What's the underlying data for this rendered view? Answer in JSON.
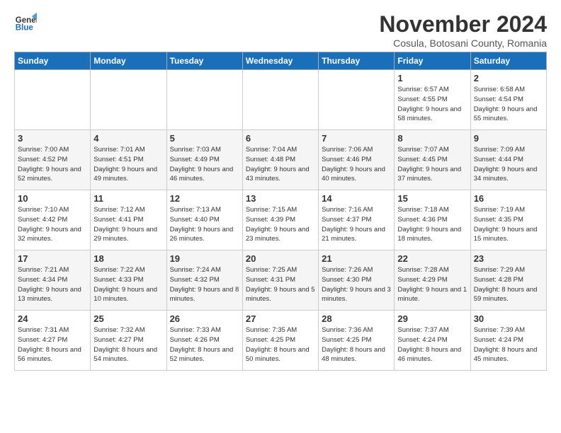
{
  "logo": {
    "line1": "General",
    "line2": "Blue"
  },
  "title": "November 2024",
  "subtitle": "Cosula, Botosani County, Romania",
  "days_of_week": [
    "Sunday",
    "Monday",
    "Tuesday",
    "Wednesday",
    "Thursday",
    "Friday",
    "Saturday"
  ],
  "weeks": [
    [
      {
        "day": "",
        "text": ""
      },
      {
        "day": "",
        "text": ""
      },
      {
        "day": "",
        "text": ""
      },
      {
        "day": "",
        "text": ""
      },
      {
        "day": "",
        "text": ""
      },
      {
        "day": "1",
        "text": "Sunrise: 6:57 AM\nSunset: 4:55 PM\nDaylight: 9 hours and 58 minutes."
      },
      {
        "day": "2",
        "text": "Sunrise: 6:58 AM\nSunset: 4:54 PM\nDaylight: 9 hours and 55 minutes."
      }
    ],
    [
      {
        "day": "3",
        "text": "Sunrise: 7:00 AM\nSunset: 4:52 PM\nDaylight: 9 hours and 52 minutes."
      },
      {
        "day": "4",
        "text": "Sunrise: 7:01 AM\nSunset: 4:51 PM\nDaylight: 9 hours and 49 minutes."
      },
      {
        "day": "5",
        "text": "Sunrise: 7:03 AM\nSunset: 4:49 PM\nDaylight: 9 hours and 46 minutes."
      },
      {
        "day": "6",
        "text": "Sunrise: 7:04 AM\nSunset: 4:48 PM\nDaylight: 9 hours and 43 minutes."
      },
      {
        "day": "7",
        "text": "Sunrise: 7:06 AM\nSunset: 4:46 PM\nDaylight: 9 hours and 40 minutes."
      },
      {
        "day": "8",
        "text": "Sunrise: 7:07 AM\nSunset: 4:45 PM\nDaylight: 9 hours and 37 minutes."
      },
      {
        "day": "9",
        "text": "Sunrise: 7:09 AM\nSunset: 4:44 PM\nDaylight: 9 hours and 34 minutes."
      }
    ],
    [
      {
        "day": "10",
        "text": "Sunrise: 7:10 AM\nSunset: 4:42 PM\nDaylight: 9 hours and 32 minutes."
      },
      {
        "day": "11",
        "text": "Sunrise: 7:12 AM\nSunset: 4:41 PM\nDaylight: 9 hours and 29 minutes."
      },
      {
        "day": "12",
        "text": "Sunrise: 7:13 AM\nSunset: 4:40 PM\nDaylight: 9 hours and 26 minutes."
      },
      {
        "day": "13",
        "text": "Sunrise: 7:15 AM\nSunset: 4:39 PM\nDaylight: 9 hours and 23 minutes."
      },
      {
        "day": "14",
        "text": "Sunrise: 7:16 AM\nSunset: 4:37 PM\nDaylight: 9 hours and 21 minutes."
      },
      {
        "day": "15",
        "text": "Sunrise: 7:18 AM\nSunset: 4:36 PM\nDaylight: 9 hours and 18 minutes."
      },
      {
        "day": "16",
        "text": "Sunrise: 7:19 AM\nSunset: 4:35 PM\nDaylight: 9 hours and 15 minutes."
      }
    ],
    [
      {
        "day": "17",
        "text": "Sunrise: 7:21 AM\nSunset: 4:34 PM\nDaylight: 9 hours and 13 minutes."
      },
      {
        "day": "18",
        "text": "Sunrise: 7:22 AM\nSunset: 4:33 PM\nDaylight: 9 hours and 10 minutes."
      },
      {
        "day": "19",
        "text": "Sunrise: 7:24 AM\nSunset: 4:32 PM\nDaylight: 9 hours and 8 minutes."
      },
      {
        "day": "20",
        "text": "Sunrise: 7:25 AM\nSunset: 4:31 PM\nDaylight: 9 hours and 5 minutes."
      },
      {
        "day": "21",
        "text": "Sunrise: 7:26 AM\nSunset: 4:30 PM\nDaylight: 9 hours and 3 minutes."
      },
      {
        "day": "22",
        "text": "Sunrise: 7:28 AM\nSunset: 4:29 PM\nDaylight: 9 hours and 1 minute."
      },
      {
        "day": "23",
        "text": "Sunrise: 7:29 AM\nSunset: 4:28 PM\nDaylight: 8 hours and 59 minutes."
      }
    ],
    [
      {
        "day": "24",
        "text": "Sunrise: 7:31 AM\nSunset: 4:27 PM\nDaylight: 8 hours and 56 minutes."
      },
      {
        "day": "25",
        "text": "Sunrise: 7:32 AM\nSunset: 4:27 PM\nDaylight: 8 hours and 54 minutes."
      },
      {
        "day": "26",
        "text": "Sunrise: 7:33 AM\nSunset: 4:26 PM\nDaylight: 8 hours and 52 minutes."
      },
      {
        "day": "27",
        "text": "Sunrise: 7:35 AM\nSunset: 4:25 PM\nDaylight: 8 hours and 50 minutes."
      },
      {
        "day": "28",
        "text": "Sunrise: 7:36 AM\nSunset: 4:25 PM\nDaylight: 8 hours and 48 minutes."
      },
      {
        "day": "29",
        "text": "Sunrise: 7:37 AM\nSunset: 4:24 PM\nDaylight: 8 hours and 46 minutes."
      },
      {
        "day": "30",
        "text": "Sunrise: 7:39 AM\nSunset: 4:24 PM\nDaylight: 8 hours and 45 minutes."
      }
    ]
  ]
}
